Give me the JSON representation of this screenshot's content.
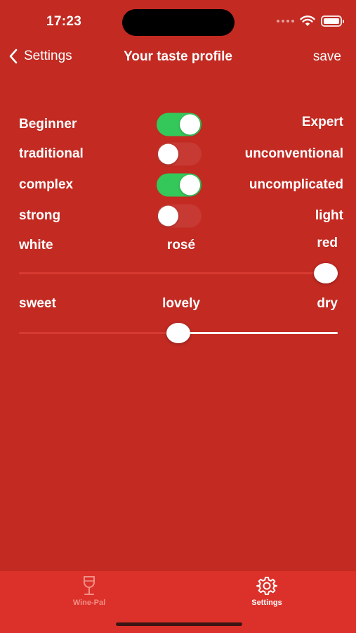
{
  "status_bar": {
    "time": "17:23"
  },
  "nav": {
    "back_label": "Settings",
    "title": "Your taste profile",
    "save_label": "save"
  },
  "preferences": [
    {
      "left": "Beginner",
      "right": "Expert",
      "on": true
    },
    {
      "left": "traditional",
      "right": "unconventional",
      "on": false
    },
    {
      "left": "complex",
      "right": "uncomplicated",
      "on": true
    },
    {
      "left": "strong",
      "right": "light",
      "on": false
    }
  ],
  "color_slider": {
    "left": "white",
    "center": "rosé",
    "right": "red",
    "value": 1.0
  },
  "sweetness_slider": {
    "left": "sweet",
    "center": "lovely",
    "right": "dry",
    "value": 0.5
  },
  "tabs": [
    {
      "label": "Wine-Pal",
      "icon": "wine-glass-icon",
      "active": false
    },
    {
      "label": "Settings",
      "icon": "gear-icon",
      "active": true
    }
  ],
  "colors": {
    "background": "#c22a22",
    "tabbar": "#dc312a",
    "toggle_on": "#34c759",
    "accent_text": "#ffffff"
  }
}
